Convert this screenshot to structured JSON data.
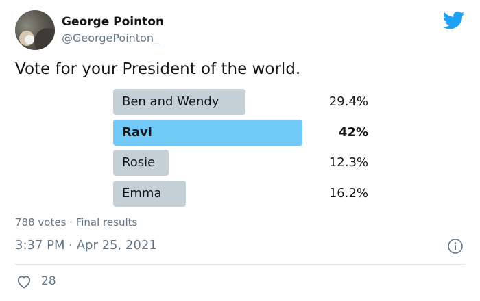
{
  "author": {
    "name": "George Pointon",
    "handle": "@GeorgePointon_",
    "avatar_icon": "user-avatar"
  },
  "brand": {
    "icon": "twitter-bird-icon",
    "color": "#1da1f2"
  },
  "tweet": {
    "text": "Vote for your President of the world."
  },
  "poll": {
    "options": [
      {
        "label": "Ben and Wendy",
        "percent": "29.4%",
        "value": 29.4,
        "winner": false
      },
      {
        "label": "Ravi",
        "percent": "42%",
        "value": 42,
        "winner": true
      },
      {
        "label": "Rosie",
        "percent": "12.3%",
        "value": 12.3,
        "winner": false
      },
      {
        "label": "Emma",
        "percent": "16.2%",
        "value": 16.2,
        "winner": false
      }
    ],
    "votes": "788 votes",
    "status": "Final results",
    "colors": {
      "bar": "#c4cfd6",
      "winner_bar": "#71c9f8"
    }
  },
  "meta": {
    "time": "3:37 PM",
    "date": "Apr 25, 2021",
    "info_icon": "info-icon"
  },
  "actions": {
    "like_icon": "heart-icon",
    "likes": "28"
  }
}
